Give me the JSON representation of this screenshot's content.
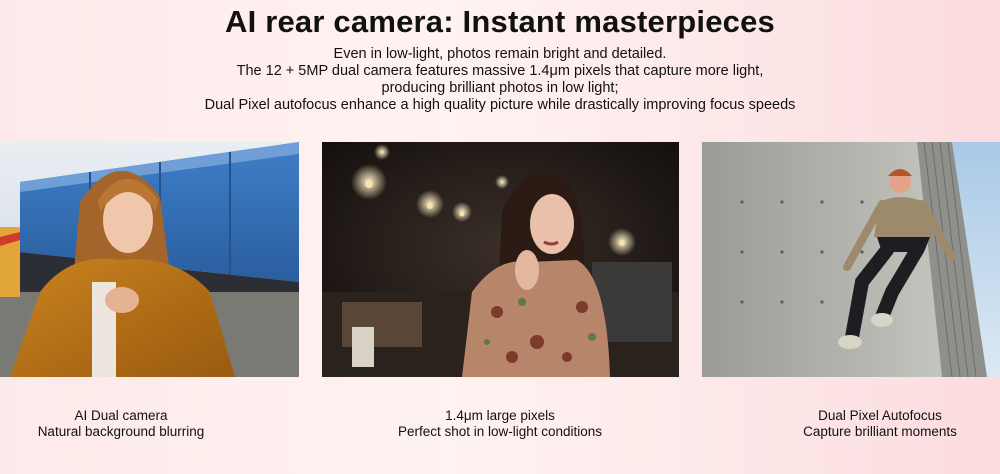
{
  "header": {
    "title": "AI rear camera: Instant masterpieces",
    "description_lines": [
      "Even in low-light, photos remain bright and detailed.",
      "The 12 + 5MP dual camera features massive 1.4μm pixels that capture more light,",
      "producing brilliant photos in low light;",
      "Dual Pixel autofocus enhance a high quality picture while drastically improving focus speeds"
    ]
  },
  "features": [
    {
      "line1": "AI Dual camera",
      "line2": "Natural background blurring"
    },
    {
      "line1": "1.4μm large pixels",
      "line2": "Perfect shot in low-light conditions"
    },
    {
      "line1": "Dual Pixel Autofocus",
      "line2": "Capture brilliant moments"
    }
  ],
  "colors": {
    "background_left": "#fde9e9",
    "background_right": "#fcdcdf",
    "text": "#111111"
  }
}
